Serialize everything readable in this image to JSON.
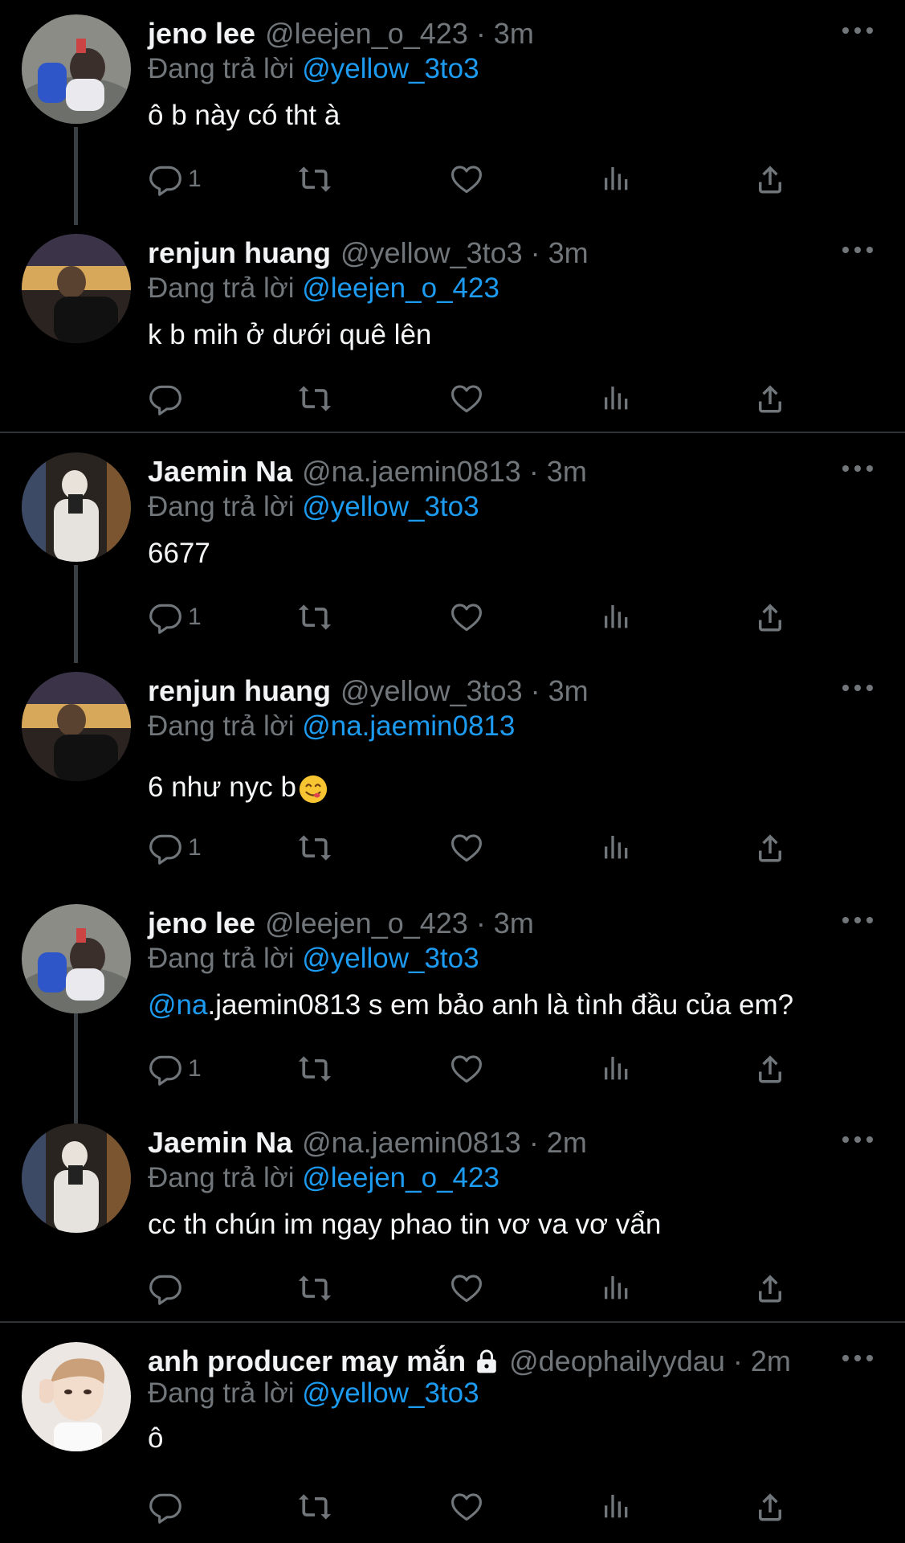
{
  "reply_prefix": "Đang trả lời",
  "tweets": [
    {
      "name": "jeno lee",
      "handle": "@leejen_o_423 · 3m",
      "reply_to": "@yellow_3to3",
      "text": "ô b này có tht à",
      "replies": "1"
    },
    {
      "name": "renjun huang",
      "handle": "@yellow_3to3 · 3m",
      "reply_to": "@leejen_o_423",
      "text": "k b mih ở dưới quê lên",
      "replies": ""
    },
    {
      "name": "Jaemin Na",
      "handle": "@na.jaemin0813 · 3m",
      "reply_to": "@yellow_3to3",
      "text": "6677",
      "replies": "1"
    },
    {
      "name": "renjun huang",
      "handle": "@yellow_3to3 · 3m",
      "reply_to": "@na.jaemin0813",
      "text": "6 như nyc b",
      "replies": "1"
    },
    {
      "name": "jeno lee",
      "handle": "@leejen_o_423 · 3m",
      "reply_to": "@yellow_3to3",
      "text_mention": "@na",
      "text": ".jaemin0813 s em bảo anh là tình đầu của em?",
      "replies": "1"
    },
    {
      "name": "Jaemin Na",
      "handle": "@na.jaemin0813 · 2m",
      "reply_to": "@leejen_o_423",
      "text": "cc th chún im ngay phao tin vơ va vơ vẩn",
      "replies": ""
    },
    {
      "name": "anh producer may mắn",
      "handle": "@deophailyydau · 2m",
      "reply_to": "@yellow_3to3",
      "text": "ô",
      "replies": ""
    }
  ],
  "icons": {
    "reply": "reply-icon",
    "retweet": "retweet-icon",
    "like": "heart-icon",
    "views": "views-icon",
    "share": "share-icon",
    "more": "more-icon",
    "lock": "lock-icon",
    "emoji": "yum-emoji"
  },
  "colors": {
    "background": "#000000",
    "accent": "#1d9bf0",
    "muted": "#71767b",
    "text": "#e7e9ea"
  }
}
